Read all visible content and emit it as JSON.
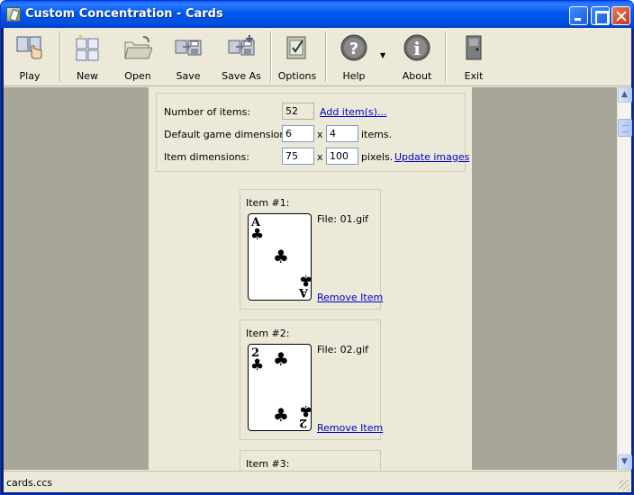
{
  "window": {
    "title": "Custom Concentration - Cards"
  },
  "toolbar": {
    "play": "Play",
    "new": "New",
    "open": "Open",
    "save": "Save",
    "save_as": "Save As",
    "options": "Options",
    "help": "Help",
    "about": "About",
    "exit": "Exit"
  },
  "settings": {
    "num_items_label": "Number of items:",
    "num_items_value": "52",
    "add_items_link": "Add item(s)...",
    "default_dims_label": "Default game dimensions:",
    "default_dims_w": "6",
    "default_dims_h": "4",
    "x_sep": "x",
    "items_unit": "items.",
    "item_dims_label": "Item dimensions:",
    "item_dims_w": "75",
    "item_dims_h": "100",
    "pixels_unit": "pixels.",
    "update_images_link": "Update images"
  },
  "items": [
    {
      "title": "Item #1:",
      "file": "File: 01.gif",
      "rank": "A",
      "suit": "♣",
      "remove": "Remove Item"
    },
    {
      "title": "Item #2:",
      "file": "File: 02.gif",
      "rank": "2",
      "suit": "♣",
      "remove": "Remove Item"
    },
    {
      "title": "Item #3:"
    }
  ],
  "status": {
    "filename": "cards.ccs"
  },
  "colors": {
    "title_blue": "#0058EE",
    "face": "#ECE9D8",
    "backdrop": "#A8A699",
    "link": "#0000CC"
  }
}
